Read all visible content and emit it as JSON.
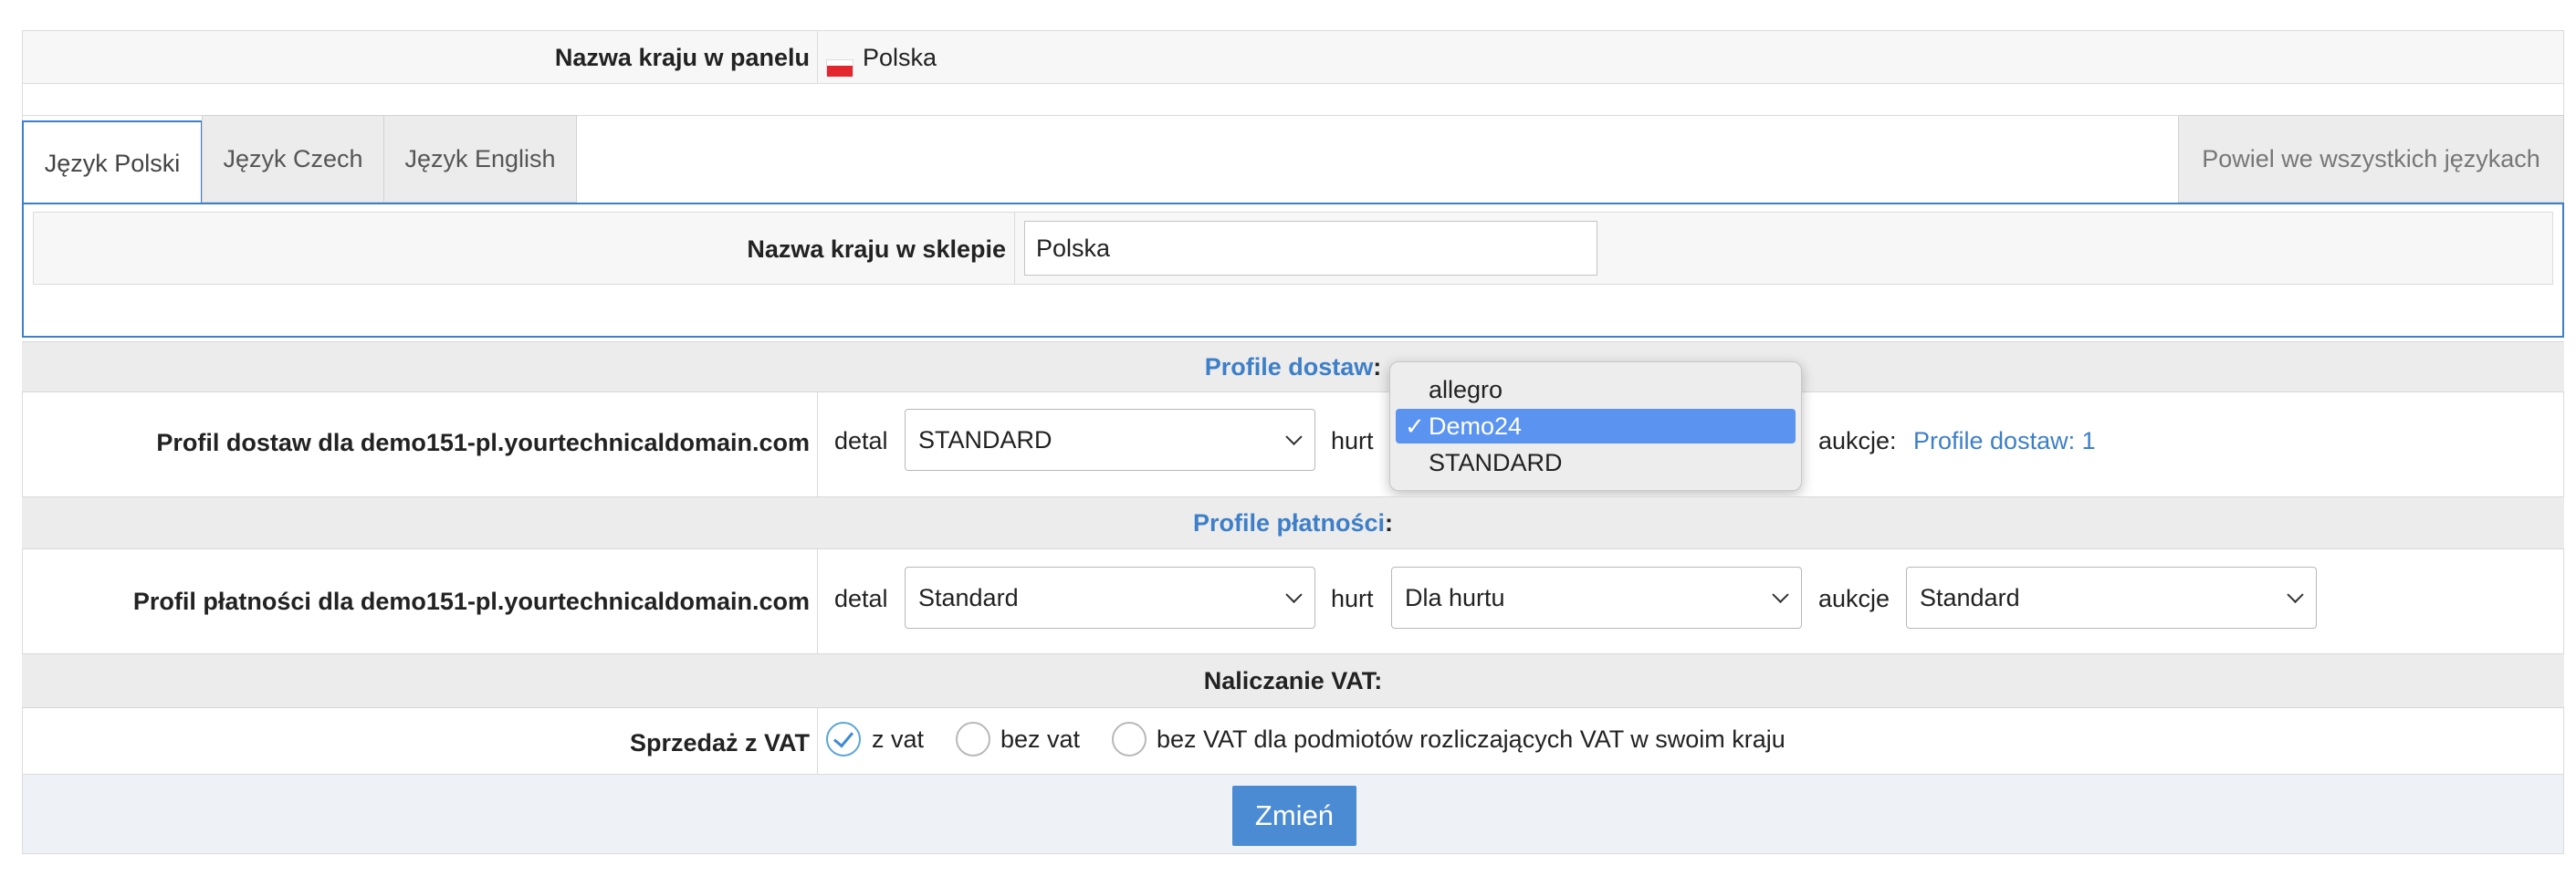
{
  "country_panel": {
    "label": "Nazwa kraju w panelu",
    "value": "Polska"
  },
  "tabs": [
    {
      "label": "Język Polski",
      "active": true
    },
    {
      "label": "Język Czech",
      "active": false
    },
    {
      "label": "Język English",
      "active": false
    }
  ],
  "duplicate_all": "Powiel we wszystkich językach",
  "shop_name": {
    "label": "Nazwa kraju w sklepie",
    "value": "Polska"
  },
  "delivery": {
    "section_title": "Profile dostaw",
    "section_colon": ":",
    "row_label": "Profil dostaw dla demo151-pl.yourtechnicaldomain.com",
    "detal_label": "detal",
    "detal_value": "STANDARD",
    "hurt_label": "hurt",
    "aukcje_label": "aukcje:",
    "aukcje_link": "Profile dostaw: 1",
    "dropdown_options": [
      "allegro",
      "Demo24",
      "STANDARD"
    ],
    "dropdown_selected": "Demo24",
    "check_glyph": "✓"
  },
  "payment": {
    "section_title": "Profile płatności",
    "section_colon": ":",
    "row_label": "Profil płatności dla demo151-pl.yourtechnicaldomain.com",
    "detal_label": "detal",
    "detal_value": "Standard",
    "hurt_label": "hurt",
    "hurt_value": "Dla hurtu",
    "aukcje_label": "aukcje",
    "aukcje_value": "Standard"
  },
  "vat": {
    "section_title": "Naliczanie VAT:",
    "row_label": "Sprzedaż z VAT",
    "options": [
      "z vat",
      "bez vat",
      "bez VAT dla podmiotów rozliczających VAT w swoim kraju"
    ],
    "selected": "z vat"
  },
  "submit_label": "Zmień",
  "colors": {
    "accent": "#3d7fc8",
    "button": "#4a8bd4",
    "dropdown_highlight": "#5b93f0",
    "flag_red": "#e4262e"
  }
}
